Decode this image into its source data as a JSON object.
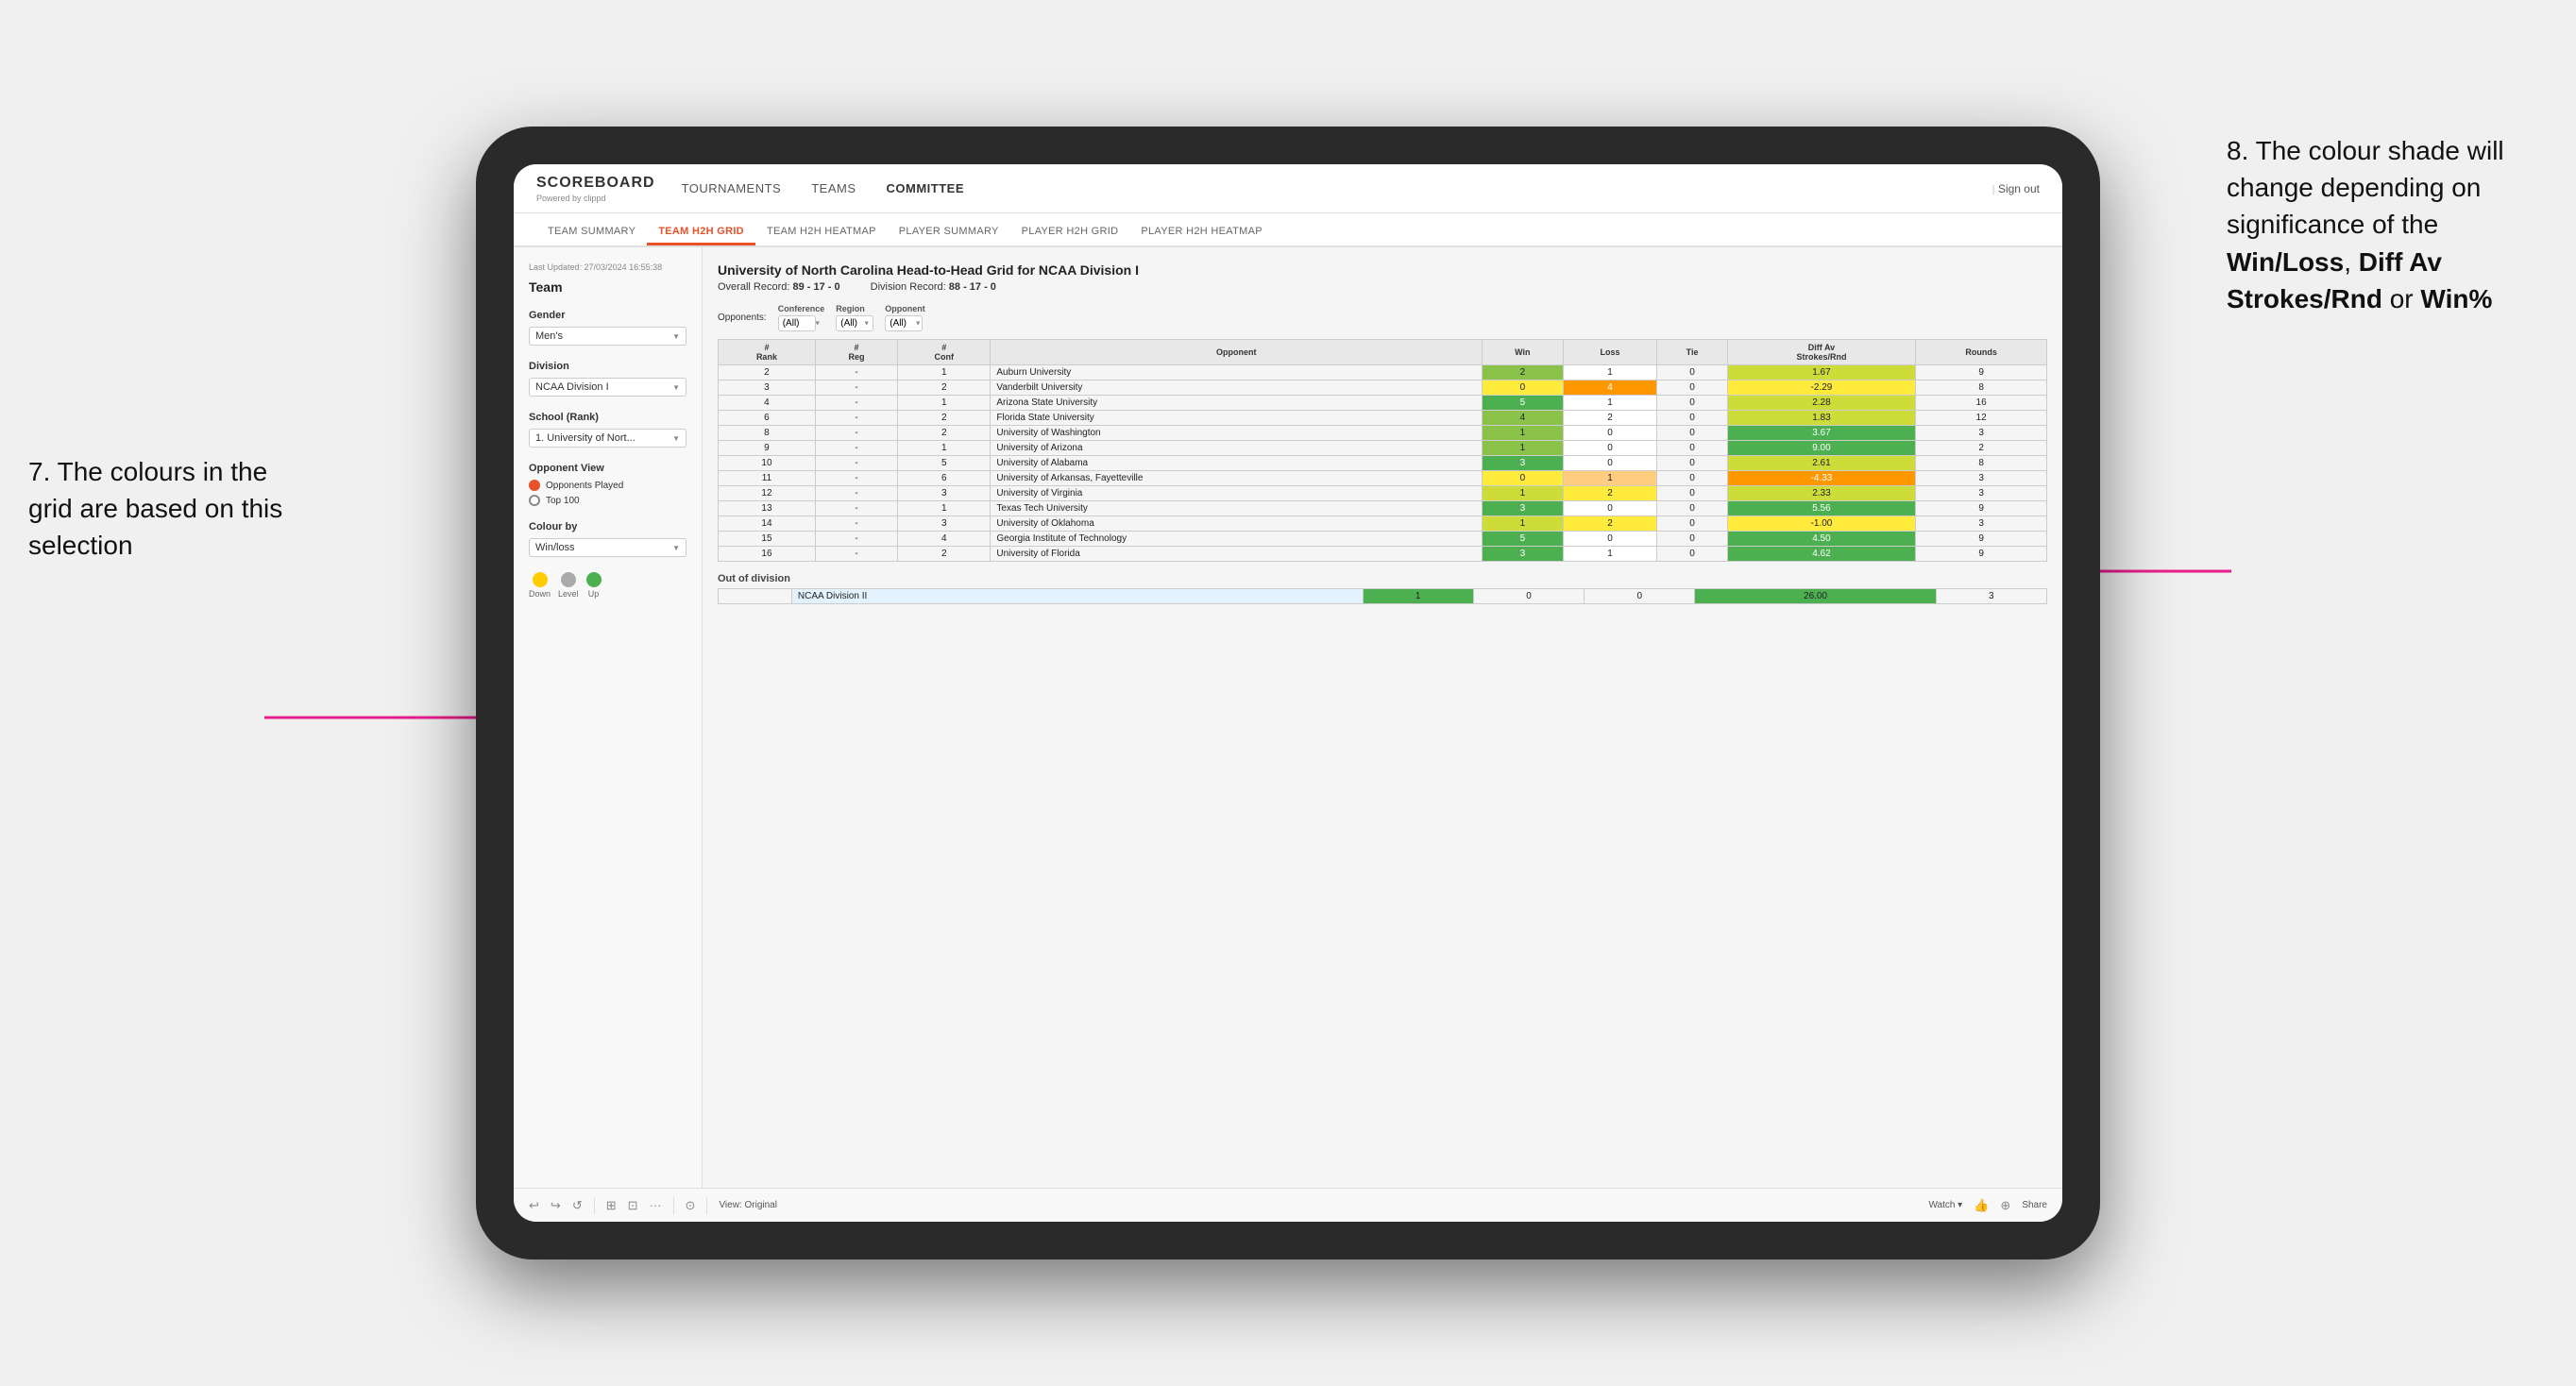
{
  "annotations": {
    "left_title": "7. The colours in the grid are based on this selection",
    "right_title": "8. The colour shade will change depending on significance of the ",
    "right_bold1": "Win/Loss",
    "right_sep1": ", ",
    "right_bold2": "Diff Av Strokes/Rnd",
    "right_sep2": " or ",
    "right_bold3": "Win%"
  },
  "nav": {
    "logo": "SCOREBOARD",
    "logo_sub": "Powered by clippd",
    "items": [
      "TOURNAMENTS",
      "TEAMS",
      "COMMITTEE"
    ],
    "sign_out": "Sign out"
  },
  "sub_nav": {
    "items": [
      "TEAM SUMMARY",
      "TEAM H2H GRID",
      "TEAM H2H HEATMAP",
      "PLAYER SUMMARY",
      "PLAYER H2H GRID",
      "PLAYER H2H HEATMAP"
    ],
    "active": "TEAM H2H GRID"
  },
  "sidebar": {
    "timestamp": "Last Updated: 27/03/2024 16:55:38",
    "team_label": "Team",
    "gender_label": "Gender",
    "gender_value": "Men's",
    "division_label": "Division",
    "division_value": "NCAA Division I",
    "school_label": "School (Rank)",
    "school_value": "1. University of Nort...",
    "opponent_view_label": "Opponent View",
    "radio_options": [
      "Opponents Played",
      "Top 100"
    ],
    "radio_selected": "Opponents Played",
    "colour_by_label": "Colour by",
    "colour_by_value": "Win/loss",
    "legend": {
      "down": "Down",
      "level": "Level",
      "up": "Up"
    }
  },
  "grid": {
    "title": "University of North Carolina Head-to-Head Grid for NCAA Division I",
    "overall_record_label": "Overall Record:",
    "overall_record_value": "89 - 17 - 0",
    "division_record_label": "Division Record:",
    "division_record_value": "88 - 17 - 0",
    "filters": {
      "opponents_label": "Opponents:",
      "conference_label": "Conference",
      "conference_value": "(All)",
      "region_label": "Region",
      "region_value": "(All)",
      "opponent_label": "Opponent",
      "opponent_value": "(All)"
    },
    "columns": [
      "#\nRank",
      "#\nReg",
      "#\nConf",
      "Opponent",
      "Win",
      "Loss",
      "Tie",
      "Diff Av\nStrokes/Rnd",
      "Rounds"
    ],
    "rows": [
      {
        "rank": "2",
        "reg": "-",
        "conf": "1",
        "opponent": "Auburn University",
        "win": 2,
        "loss": 1,
        "tie": 0,
        "diff": "1.67",
        "rounds": 9,
        "win_color": "green_med",
        "loss_color": "white",
        "diff_color": "green_light"
      },
      {
        "rank": "3",
        "reg": "-",
        "conf": "2",
        "opponent": "Vanderbilt University",
        "win": 0,
        "loss": 4,
        "tie": 0,
        "diff": "-2.29",
        "rounds": 8,
        "win_color": "yellow",
        "loss_color": "orange",
        "diff_color": "yellow"
      },
      {
        "rank": "4",
        "reg": "-",
        "conf": "1",
        "opponent": "Arizona State University",
        "win": 5,
        "loss": 1,
        "tie": 0,
        "diff": "2.28",
        "rounds": 16,
        "win_color": "green_dark",
        "loss_color": "white",
        "diff_color": "green_light"
      },
      {
        "rank": "6",
        "reg": "-",
        "conf": "2",
        "opponent": "Florida State University",
        "win": 4,
        "loss": 2,
        "tie": 0,
        "diff": "1.83",
        "rounds": 12,
        "win_color": "green_med",
        "loss_color": "white",
        "diff_color": "green_light"
      },
      {
        "rank": "8",
        "reg": "-",
        "conf": "2",
        "opponent": "University of Washington",
        "win": 1,
        "loss": 0,
        "tie": 0,
        "diff": "3.67",
        "rounds": 3,
        "win_color": "green_med",
        "loss_color": "white",
        "diff_color": "green_dark"
      },
      {
        "rank": "9",
        "reg": "-",
        "conf": "1",
        "opponent": "University of Arizona",
        "win": 1,
        "loss": 0,
        "tie": 0,
        "diff": "9.00",
        "rounds": 2,
        "win_color": "green_med",
        "loss_color": "white",
        "diff_color": "green_dark"
      },
      {
        "rank": "10",
        "reg": "-",
        "conf": "5",
        "opponent": "University of Alabama",
        "win": 3,
        "loss": 0,
        "tie": 0,
        "diff": "2.61",
        "rounds": 8,
        "win_color": "green_dark",
        "loss_color": "white",
        "diff_color": "green_light"
      },
      {
        "rank": "11",
        "reg": "-",
        "conf": "6",
        "opponent": "University of Arkansas, Fayetteville",
        "win": 0,
        "loss": 1,
        "tie": 0,
        "diff": "-4.33",
        "rounds": 3,
        "win_color": "yellow",
        "loss_color": "orange_light",
        "diff_color": "orange"
      },
      {
        "rank": "12",
        "reg": "-",
        "conf": "3",
        "opponent": "University of Virginia",
        "win": 1,
        "loss": 2,
        "tie": 0,
        "diff": "2.33",
        "rounds": 3,
        "win_color": "green_light",
        "loss_color": "yellow",
        "diff_color": "green_light"
      },
      {
        "rank": "13",
        "reg": "-",
        "conf": "1",
        "opponent": "Texas Tech University",
        "win": 3,
        "loss": 0,
        "tie": 0,
        "diff": "5.56",
        "rounds": 9,
        "win_color": "green_dark",
        "loss_color": "white",
        "diff_color": "green_dark"
      },
      {
        "rank": "14",
        "reg": "-",
        "conf": "3",
        "opponent": "University of Oklahoma",
        "win": 1,
        "loss": 2,
        "tie": 0,
        "diff": "-1.00",
        "rounds": 3,
        "win_color": "green_light",
        "loss_color": "yellow",
        "diff_color": "yellow"
      },
      {
        "rank": "15",
        "reg": "-",
        "conf": "4",
        "opponent": "Georgia Institute of Technology",
        "win": 5,
        "loss": 0,
        "tie": 0,
        "diff": "4.50",
        "rounds": 9,
        "win_color": "green_dark",
        "loss_color": "white",
        "diff_color": "green_dark"
      },
      {
        "rank": "16",
        "reg": "-",
        "conf": "2",
        "opponent": "University of Florida",
        "win": 3,
        "loss": 1,
        "tie": 0,
        "diff": "4.62",
        "rounds": 9,
        "win_color": "green_dark",
        "loss_color": "white",
        "diff_color": "green_dark"
      }
    ],
    "out_of_division_label": "Out of division",
    "out_of_division_row": {
      "division": "NCAA Division II",
      "win": 1,
      "loss": 0,
      "tie": 0,
      "diff": "26.00",
      "rounds": 3,
      "win_color": "green_dark",
      "diff_color": "green_dark"
    }
  },
  "toolbar": {
    "buttons": [
      "↩",
      "↪",
      "⤼",
      "⊞",
      "⊡",
      "·",
      "⊙"
    ],
    "view_label": "View: Original",
    "watch_label": "Watch ▾",
    "share_label": "Share"
  }
}
